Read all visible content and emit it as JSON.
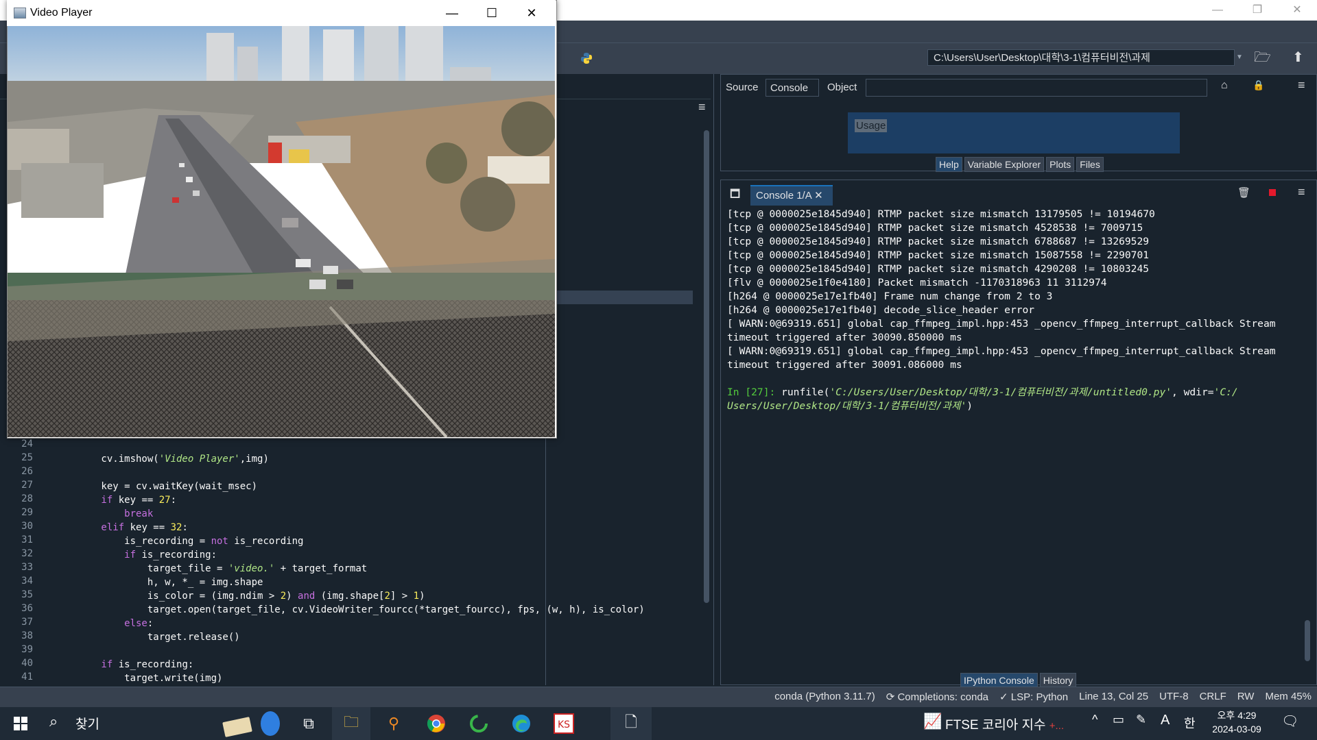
{
  "spyder": {
    "window_controls": [
      "—",
      "❐",
      "✕"
    ],
    "working_dir": "C:\\Users\\User\\Desktop\\대학\\3-1\\컴퓨터비전\\과제"
  },
  "help": {
    "source_label": "Source",
    "source_value": "Console",
    "object_label": "Object",
    "object_value": "",
    "usage_title": "Usage",
    "tabs": [
      "Help",
      "Variable Explorer",
      "Plots",
      "Files"
    ]
  },
  "console": {
    "tab_label": "Console 1/A",
    "lines": [
      "[tcp @ 0000025e1845d940] RTMP packet size mismatch 13179505 != 10194670",
      "[tcp @ 0000025e1845d940] RTMP packet size mismatch 4528538 != 7009715",
      "[tcp @ 0000025e1845d940] RTMP packet size mismatch 6788687 != 13269529",
      "[tcp @ 0000025e1845d940] RTMP packet size mismatch 15087558 != 2290701",
      "[tcp @ 0000025e1845d940] RTMP packet size mismatch 4290208 != 10803245",
      "[flv @ 0000025e1f0e4180] Packet mismatch -1170318963 11 3112974",
      "[h264 @ 0000025e17e1fb40] Frame num change from 2 to 3",
      "[h264 @ 0000025e17e1fb40] decode_slice_header error",
      "[ WARN:0@69319.651] global cap_ffmpeg_impl.hpp:453 _opencv_ffmpeg_interrupt_callback Stream",
      "timeout triggered after 30090.850000 ms",
      "[ WARN:0@69319.651] global cap_ffmpeg_impl.hpp:453 _opencv_ffmpeg_interrupt_callback Stream",
      "timeout triggered after 30091.086000 ms"
    ],
    "prompt_label": "In [27]:",
    "run_cmd_1": " runfile(",
    "run_arg_1": "'C:/Users/User/Desktop/대학/3-1/컴퓨터비전/과제/untitled0.py'",
    "run_cmd_2": ", wdir=",
    "run_arg_2a": "'C:/",
    "run_arg_2b": "Users/User/Desktop/대학/3-1/컴퓨터비전/과제'",
    "run_cmd_3": ")",
    "bottom_tabs": [
      "IPython Console",
      "History"
    ]
  },
  "editor": {
    "line_numbers": [
      "24",
      "25",
      "26",
      "27",
      "28",
      "29",
      "30",
      "31",
      "32",
      "33",
      "34",
      "35",
      "36",
      "37",
      "38",
      "39",
      "40",
      "41"
    ],
    "code": {
      "l25_a": "        cv.imshow(",
      "l25_s": "'Video Player'",
      "l25_b": ",img)",
      "l27": "        key = cv.waitKey(wait_msec)",
      "l28_k": "        if",
      "l28_b": " key == ",
      "l28_n": "27",
      "l28_c": ":",
      "l29": "            break",
      "l30_k": "        elif",
      "l30_b": " key == ",
      "l30_n": "32",
      "l30_c": ":",
      "l31_a": "            is_recording = ",
      "l31_k": "not",
      "l31_b": " is_recording",
      "l32_k": "            if",
      "l32_b": " is_recording:",
      "l33_a": "                target_file = ",
      "l33_s": "'video.'",
      "l33_b": " + target_format",
      "l34": "                h, w, *_ = img.shape",
      "l35_a": "                is_color = (img.ndim > ",
      "l35_n1": "2",
      "l35_b": ") ",
      "l35_k": "and",
      "l35_c": " (img.shape[",
      "l35_n2": "2",
      "l35_d": "] > ",
      "l35_n3": "1",
      "l35_e": ")",
      "l36": "                target.open(target_file, cv.VideoWriter_fourcc(*target_fourcc), fps, (w, h), is_color)",
      "l37_k": "            else",
      "l37_b": ":",
      "l38": "                target.release()",
      "l40_k": "        if",
      "l40_b": " is_recording:",
      "l41": "            target.write(img)"
    }
  },
  "status": {
    "items": [
      "conda (Python 3.11.7)",
      "Completions: conda",
      "LSP: Python",
      "Line 13, Col 25",
      "UTF-8",
      "CRLF",
      "RW",
      "Mem 45%"
    ]
  },
  "video": {
    "title": "Video Player",
    "controls": [
      "—",
      "☐",
      "✕"
    ]
  },
  "taskbar": {
    "search_label": "찾기",
    "news": "FTSE 코리아 지수",
    "news_more": "+...",
    "ime_a": "A",
    "ime_han": "한",
    "time": "오후 4:29",
    "date": "2024-03-09"
  }
}
